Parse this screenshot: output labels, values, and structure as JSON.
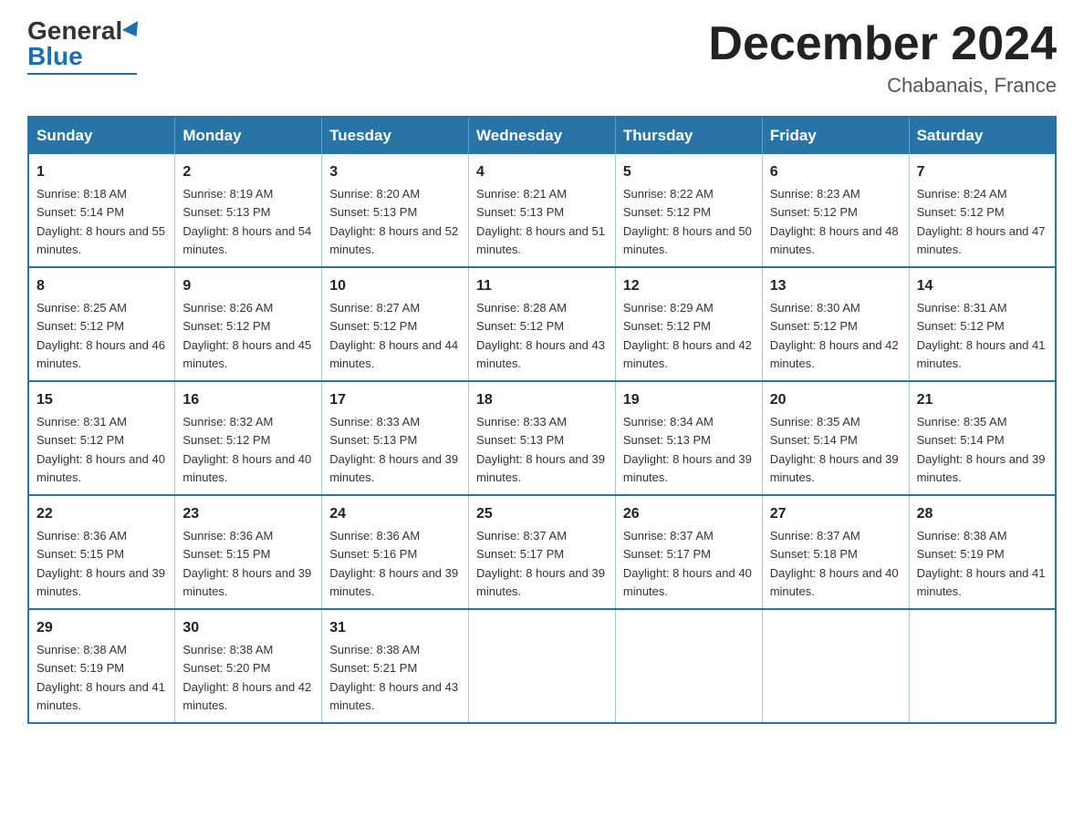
{
  "logo": {
    "general": "General",
    "blue": "Blue",
    "underline": true
  },
  "title": {
    "month_year": "December 2024",
    "location": "Chabanais, France"
  },
  "headers": [
    "Sunday",
    "Monday",
    "Tuesday",
    "Wednesday",
    "Thursday",
    "Friday",
    "Saturday"
  ],
  "weeks": [
    [
      {
        "day": "1",
        "sunrise": "8:18 AM",
        "sunset": "5:14 PM",
        "daylight": "8 hours and 55 minutes."
      },
      {
        "day": "2",
        "sunrise": "8:19 AM",
        "sunset": "5:13 PM",
        "daylight": "8 hours and 54 minutes."
      },
      {
        "day": "3",
        "sunrise": "8:20 AM",
        "sunset": "5:13 PM",
        "daylight": "8 hours and 52 minutes."
      },
      {
        "day": "4",
        "sunrise": "8:21 AM",
        "sunset": "5:13 PM",
        "daylight": "8 hours and 51 minutes."
      },
      {
        "day": "5",
        "sunrise": "8:22 AM",
        "sunset": "5:12 PM",
        "daylight": "8 hours and 50 minutes."
      },
      {
        "day": "6",
        "sunrise": "8:23 AM",
        "sunset": "5:12 PM",
        "daylight": "8 hours and 48 minutes."
      },
      {
        "day": "7",
        "sunrise": "8:24 AM",
        "sunset": "5:12 PM",
        "daylight": "8 hours and 47 minutes."
      }
    ],
    [
      {
        "day": "8",
        "sunrise": "8:25 AM",
        "sunset": "5:12 PM",
        "daylight": "8 hours and 46 minutes."
      },
      {
        "day": "9",
        "sunrise": "8:26 AM",
        "sunset": "5:12 PM",
        "daylight": "8 hours and 45 minutes."
      },
      {
        "day": "10",
        "sunrise": "8:27 AM",
        "sunset": "5:12 PM",
        "daylight": "8 hours and 44 minutes."
      },
      {
        "day": "11",
        "sunrise": "8:28 AM",
        "sunset": "5:12 PM",
        "daylight": "8 hours and 43 minutes."
      },
      {
        "day": "12",
        "sunrise": "8:29 AM",
        "sunset": "5:12 PM",
        "daylight": "8 hours and 42 minutes."
      },
      {
        "day": "13",
        "sunrise": "8:30 AM",
        "sunset": "5:12 PM",
        "daylight": "8 hours and 42 minutes."
      },
      {
        "day": "14",
        "sunrise": "8:31 AM",
        "sunset": "5:12 PM",
        "daylight": "8 hours and 41 minutes."
      }
    ],
    [
      {
        "day": "15",
        "sunrise": "8:31 AM",
        "sunset": "5:12 PM",
        "daylight": "8 hours and 40 minutes."
      },
      {
        "day": "16",
        "sunrise": "8:32 AM",
        "sunset": "5:12 PM",
        "daylight": "8 hours and 40 minutes."
      },
      {
        "day": "17",
        "sunrise": "8:33 AM",
        "sunset": "5:13 PM",
        "daylight": "8 hours and 39 minutes."
      },
      {
        "day": "18",
        "sunrise": "8:33 AM",
        "sunset": "5:13 PM",
        "daylight": "8 hours and 39 minutes."
      },
      {
        "day": "19",
        "sunrise": "8:34 AM",
        "sunset": "5:13 PM",
        "daylight": "8 hours and 39 minutes."
      },
      {
        "day": "20",
        "sunrise": "8:35 AM",
        "sunset": "5:14 PM",
        "daylight": "8 hours and 39 minutes."
      },
      {
        "day": "21",
        "sunrise": "8:35 AM",
        "sunset": "5:14 PM",
        "daylight": "8 hours and 39 minutes."
      }
    ],
    [
      {
        "day": "22",
        "sunrise": "8:36 AM",
        "sunset": "5:15 PM",
        "daylight": "8 hours and 39 minutes."
      },
      {
        "day": "23",
        "sunrise": "8:36 AM",
        "sunset": "5:15 PM",
        "daylight": "8 hours and 39 minutes."
      },
      {
        "day": "24",
        "sunrise": "8:36 AM",
        "sunset": "5:16 PM",
        "daylight": "8 hours and 39 minutes."
      },
      {
        "day": "25",
        "sunrise": "8:37 AM",
        "sunset": "5:17 PM",
        "daylight": "8 hours and 39 minutes."
      },
      {
        "day": "26",
        "sunrise": "8:37 AM",
        "sunset": "5:17 PM",
        "daylight": "8 hours and 40 minutes."
      },
      {
        "day": "27",
        "sunrise": "8:37 AM",
        "sunset": "5:18 PM",
        "daylight": "8 hours and 40 minutes."
      },
      {
        "day": "28",
        "sunrise": "8:38 AM",
        "sunset": "5:19 PM",
        "daylight": "8 hours and 41 minutes."
      }
    ],
    [
      {
        "day": "29",
        "sunrise": "8:38 AM",
        "sunset": "5:19 PM",
        "daylight": "8 hours and 41 minutes."
      },
      {
        "day": "30",
        "sunrise": "8:38 AM",
        "sunset": "5:20 PM",
        "daylight": "8 hours and 42 minutes."
      },
      {
        "day": "31",
        "sunrise": "8:38 AM",
        "sunset": "5:21 PM",
        "daylight": "8 hours and 43 minutes."
      },
      null,
      null,
      null,
      null
    ]
  ]
}
